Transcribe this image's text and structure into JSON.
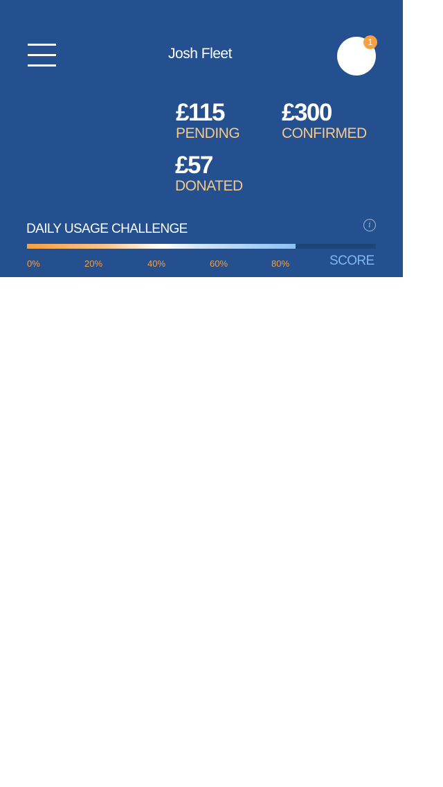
{
  "header": {
    "user_name": "Josh Fleet",
    "notification_count": "1",
    "background_color": "#24508f"
  },
  "stats": {
    "pending": {
      "amount": "£115",
      "label": "PENDING"
    },
    "confirmed": {
      "amount": "£300",
      "label": "CONFIRMED"
    },
    "donated": {
      "amount": "£57",
      "label": "DONATED"
    }
  },
  "challenge": {
    "title": "DAILY USAGE CHALLENGE",
    "progress_percent": 77,
    "ticks": [
      "0%",
      "20%",
      "40%",
      "60%",
      "80%"
    ],
    "score_label": "SCORE",
    "info_icon": "info-icon"
  }
}
